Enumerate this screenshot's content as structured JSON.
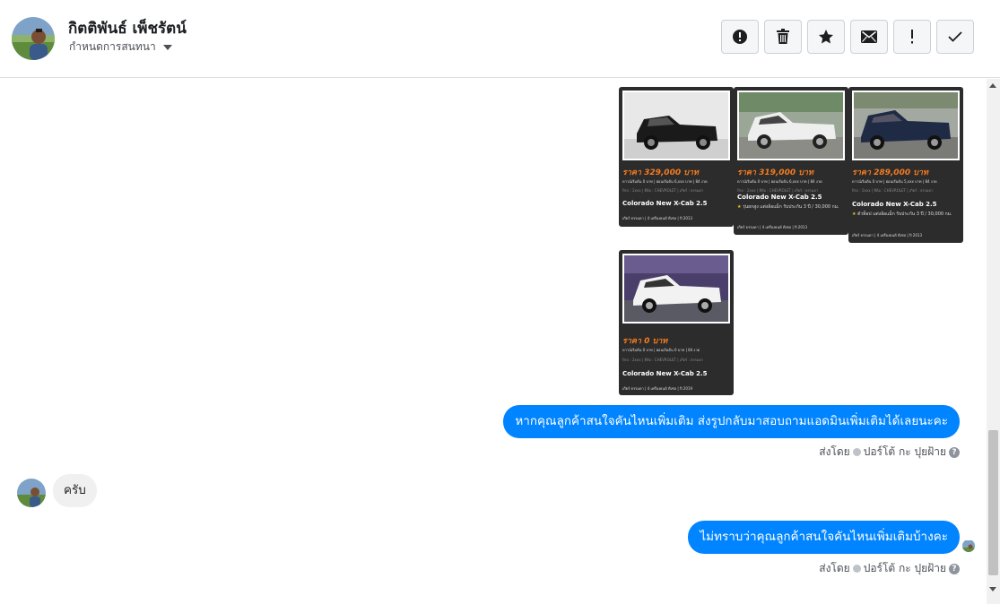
{
  "header": {
    "contact_name": "กิตติพันธ์ เพ็ชรัตน์",
    "conversation_settings_label": "กำหนดการสนทนา",
    "toolbar": [
      {
        "name": "alert-circle-icon",
        "label": "รายงานสแปม"
      },
      {
        "name": "trash-icon",
        "label": "ลบ"
      },
      {
        "name": "star-icon",
        "label": "ติดดาว"
      },
      {
        "name": "envelope-icon",
        "label": "ทำเครื่องหมายว่ายังไม่ได้อ่าน"
      },
      {
        "name": "exclamation-icon",
        "label": "ติดตามผล"
      },
      {
        "name": "checkmark-icon",
        "label": "เสร็จสิ้น"
      }
    ]
  },
  "cards": [
    {
      "price": "ราคา 329,000 บาท",
      "down": "ดาวน์เริ่มต้น 0 บาท | ผ่อนเริ่มต้น 6,xxx บาท | 84 งวด",
      "meta": "ปีรถ : 2xxx | ยี่ห้อ : CHEVROLET | เกียร์ : ธรรมดา",
      "model": "Colorado New X-Cab 2.5",
      "feature": "",
      "footer": "เกียร์ ธรรมดา | 4 เครื่องยนต์ ดีเซล | ปี 2013"
    },
    {
      "price": "ราคา 319,000 บาท",
      "down": "ดาวน์เริ่มต้น 0 บาท | ผ่อนเริ่มต้น 6,xxx บาท | 84 งวด",
      "meta": "ปีรถ : 2xxx | ยี่ห้อ : CHEVROLET | เกียร์ : ธรรมดา",
      "model": "Colorado New X-Cab 2.5",
      "feature": "รุ่นยกสูง แต่งล้อแม็ก รับประกัน 3 ปี / 30,000 กม.",
      "footer": "เกียร์ ธรรมดา | 4 เครื่องยนต์ ดีเซล | ปี 2013"
    },
    {
      "price": "ราคา 289,000 บาท",
      "down": "ดาวน์เริ่มต้น 0 บาท | ผ่อนเริ่มต้น 5,xxx บาท | 84 งวด",
      "meta": "ปีรถ : 2xxx | ยี่ห้อ : CHEVROLET | เกียร์ : ธรรมดา",
      "model": "Colorado New X-Cab 2.5",
      "feature": "ตัวท็อป แต่งล้อแม็ก รับประกัน 3 ปี / 30,000 กม.",
      "footer": "เกียร์ ธรรมดา | 4 เครื่องยนต์ ดีเซล | ปี 2013"
    },
    {
      "price": "ราคา 0 บาท",
      "down": "ดาวน์เริ่มต้น 0 บาท | ผ่อนเริ่มต้น 0 บาท | 84 งวด",
      "meta": "ปีรถ : 2xxx | ยี่ห้อ : CHEVROLET | เกียร์ : ธรรมดา",
      "model": "Colorado New X-Cab 2.5",
      "feature": "",
      "footer": "เกียร์ ธรรมดา | 4 เครื่องยนต์ ดีเซล | ปี 2019"
    }
  ],
  "messages": {
    "outgoing_1": "หากคุณลูกค้าสนใจคันไหนเพิ่มเติม ส่งรูปกลับมาสอบถามแอดมินเพิ่มเติมได้เลยนะคะ",
    "incoming_1": "ครับ",
    "outgoing_2": "ไม่ทราบว่าคุณลูกค้าสนใจคันไหนเพิ่มเติมบ้างคะ",
    "sent_by_label": "ส่งโดย",
    "sender_name": "ปอร์โต้ กะ ปุยฝ้าย",
    "help_glyph": "?"
  },
  "colors": {
    "messenger_blue": "#0084ff",
    "card_bg": "#2c2c2c",
    "price_orange": "#f47b20",
    "incoming_bubble": "#f1f0f0"
  }
}
